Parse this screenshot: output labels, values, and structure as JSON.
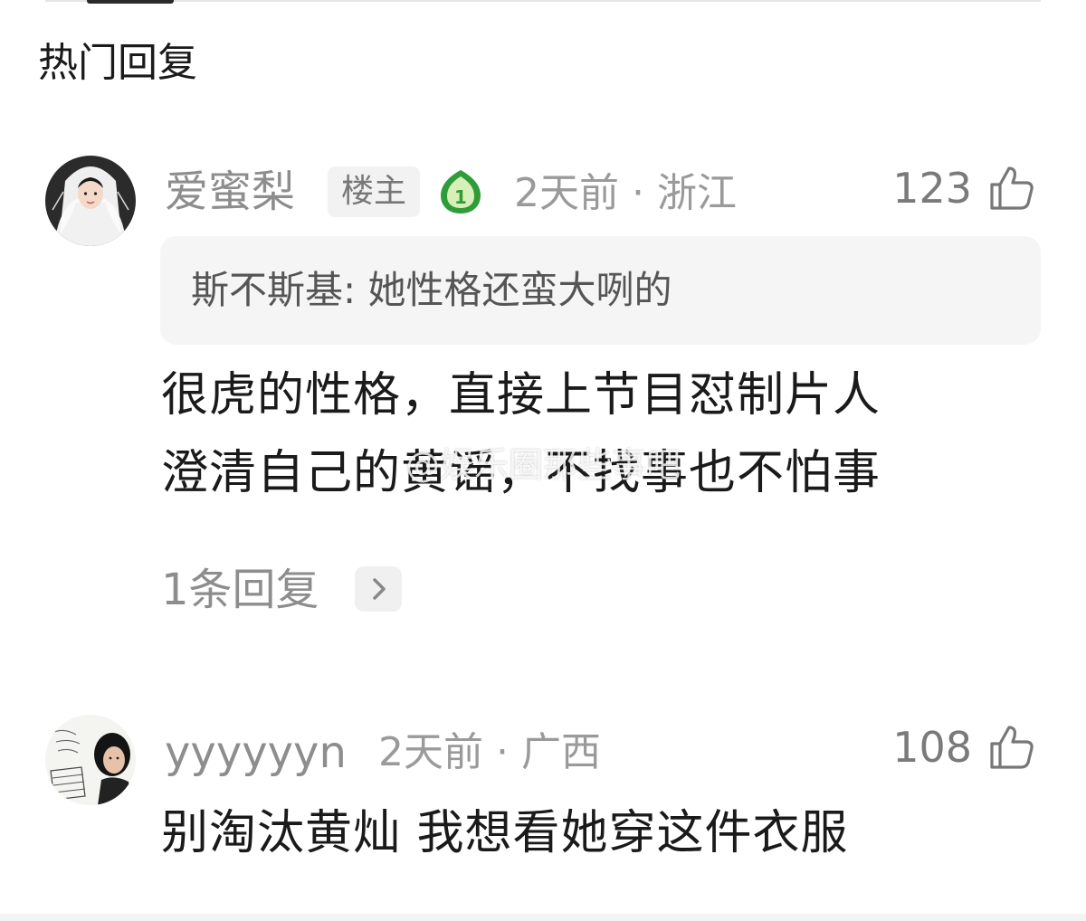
{
  "section": {
    "title": "热门回复"
  },
  "comments": [
    {
      "username": "爱蜜梨",
      "owner_badge": "楼主",
      "level": "1",
      "meta": "2天前 · 浙江",
      "likes": "123",
      "quoted_reply": "斯不斯基: 她性格还蛮大咧的",
      "body_lines": [
        "很虎的性格，直接上节目怼制片人",
        "澄清自己的黄谣，不找事也不怕事"
      ],
      "replies_label": "1条回复"
    },
    {
      "username": "yyyyyyn",
      "meta": "2天前 · 广西",
      "likes": "108",
      "body_lines": [
        "别淘汰黄灿 我想看她穿这件衣服"
      ]
    }
  ],
  "watermark": "@娱乐圈那些事吧",
  "colors": {
    "text_primary": "#1a1a1a",
    "text_secondary": "#8d8d8d",
    "level_badge_green": "#2f9c3a",
    "level_badge_light": "#d9efb8"
  },
  "icons": [
    "thumbs-up-icon",
    "level-badge-icon",
    "chevron-right-icon"
  ]
}
